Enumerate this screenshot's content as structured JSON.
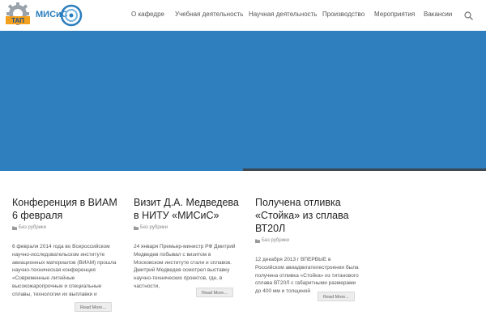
{
  "logo": {
    "gear_text": "ТАП",
    "brand_text": "МИСиС"
  },
  "nav": {
    "items": [
      {
        "label": "О кафедре"
      },
      {
        "label": "Учебная деятельность"
      },
      {
        "label": "Научная деятельность"
      },
      {
        "label": "Производство"
      },
      {
        "label": "Мероприятия"
      },
      {
        "label": "Вакансии"
      }
    ],
    "search_icon": "search-icon"
  },
  "hero": {
    "color": "#2f7fbf",
    "progress_bar_color": "#3d4852"
  },
  "posts": [
    {
      "title": "Конференция в ВИАМ 6 февраля",
      "category": "Без рубрики",
      "excerpt": "6 февраля 2014 года во Всероссийском научно-исследовательском институте авиационных материалов (ВИАМ) прошла научно-техническая конференция «Современные литейные высокожаропрочные и специальные сплавы, технологии их выплавки и",
      "read_more": "Read More..."
    },
    {
      "title": "Визит Д.А. Медведева в НИТУ «МИСиС»",
      "category": "Без рубрики",
      "excerpt": "24 января Премьер-министр РФ Дмитрий Медведев побывал с визитом в Московском институте стали и сплавов. Дмитрий Медведев осмотрел выставку научно-технических проектов, где, в частности,",
      "read_more": "Read More..."
    },
    {
      "title": "Получена отливка «Стойка» из сплава ВТ20Л",
      "category": "Без рубрики",
      "excerpt": "12 декабря 2013 г ВПЕРВЫЕ в Российском авиадвигателестроении была получена отливка «Стойка» из титанового сплава ВТ20Л с габаритными размерами до 400 мм и толщиной",
      "read_more": "Read More..."
    }
  ]
}
